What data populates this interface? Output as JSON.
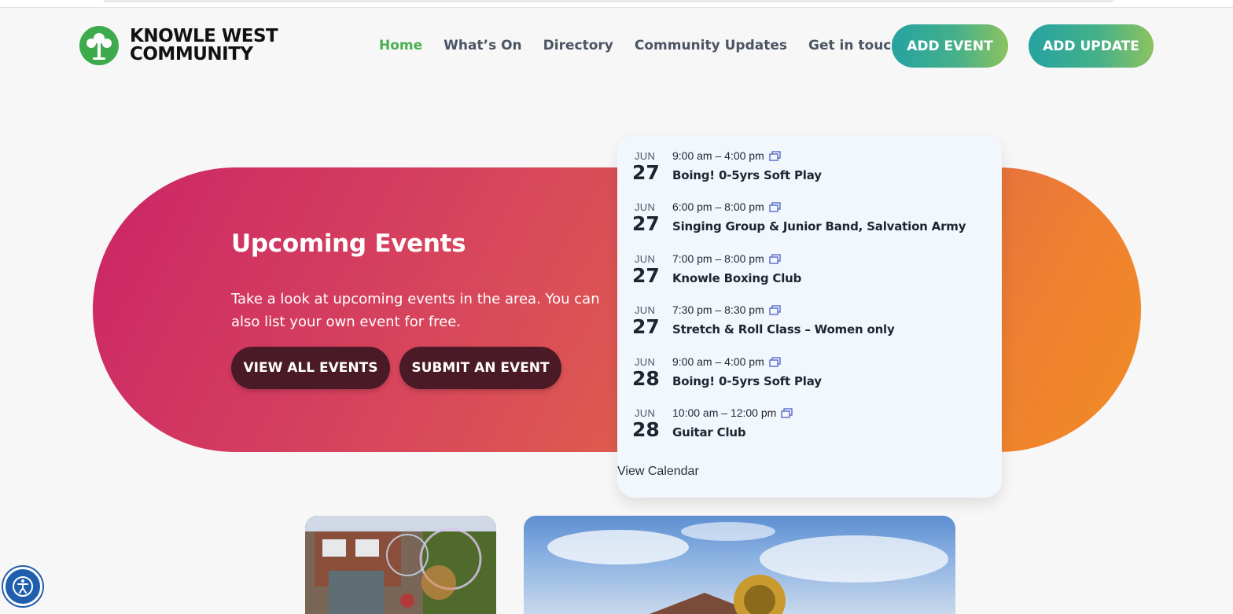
{
  "site": {
    "logo_line1": "KNOWLE WEST",
    "logo_line2": "COMMUNITY",
    "logo_icon": "tree-icon",
    "brand_green": "#3dab4b"
  },
  "nav": {
    "items": [
      {
        "label": "Home",
        "active": true
      },
      {
        "label": "What’s On"
      },
      {
        "label": "Directory"
      },
      {
        "label": "Community Updates"
      },
      {
        "label": "Get in touch",
        "has_dropdown": true
      }
    ],
    "buttons": {
      "add_event": "ADD EVENT",
      "add_update": "ADD UPDATE"
    }
  },
  "hero": {
    "title": "Upcoming Events",
    "description": "Take a look at upcoming events in the area. You can also list your own event for free.",
    "view_all_label": "VIEW ALL EVENTS",
    "submit_label": "SUBMIT AN EVENT"
  },
  "events": [
    {
      "month": "JUN",
      "day": "27",
      "time": "9:00 am – 4:00 pm",
      "title": "Boing! 0-5yrs Soft Play",
      "recurring": true
    },
    {
      "month": "JUN",
      "day": "27",
      "time": "6:00 pm – 8:00 pm",
      "title": "Singing Group & Junior Band, Salvation Army",
      "recurring": true
    },
    {
      "month": "JUN",
      "day": "27",
      "time": "7:00 pm – 8:00 pm",
      "title": "Knowle Boxing Club",
      "recurring": true
    },
    {
      "month": "JUN",
      "day": "27",
      "time": "7:30 pm – 8:30 pm",
      "title": "Stretch & Roll Class – Women only",
      "recurring": true
    },
    {
      "month": "JUN",
      "day": "28",
      "time": "9:00 am – 4:00 pm",
      "title": "Boing! 0-5yrs Soft Play",
      "recurring": true
    },
    {
      "month": "JUN",
      "day": "28",
      "time": "10:00 am – 12:00 pm",
      "title": "Guitar Club",
      "recurring": true
    }
  ],
  "view_calendar_label": "View Calendar",
  "accessibility_icon": "accessibility-icon"
}
